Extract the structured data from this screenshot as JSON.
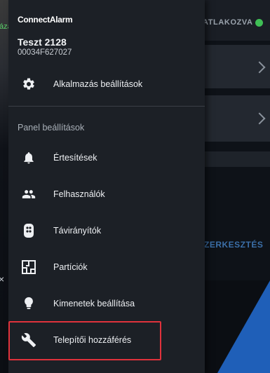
{
  "background": {
    "status_left": "ázá",
    "status_right": "ATLAKOZVA",
    "edit_label": "ZERKESZTÉS",
    "cross_glyph": "×"
  },
  "drawer": {
    "brand": "ConnectAlarm",
    "user": {
      "name": "Teszt 2128",
      "id": "00034F627027"
    },
    "app_settings_label": "Alkalmazás beállítások",
    "section_title": "Panel beállítások",
    "items": [
      {
        "label": "Értesítések",
        "icon": "bell-icon"
      },
      {
        "label": "Felhasználók",
        "icon": "users-icon"
      },
      {
        "label": "Távirányítók",
        "icon": "remote-icon"
      },
      {
        "label": "Partíciók",
        "icon": "floorplan-icon"
      },
      {
        "label": "Kimenetek beállítása",
        "icon": "lightbulb-icon"
      },
      {
        "label": "Telepítői hozzáférés",
        "icon": "wrench-icon"
      }
    ]
  },
  "colors": {
    "drawer_bg": "#1c2026",
    "highlight": "#e0323c",
    "status_green": "#3fbf55",
    "accent_blue": "#1f5fb8"
  }
}
